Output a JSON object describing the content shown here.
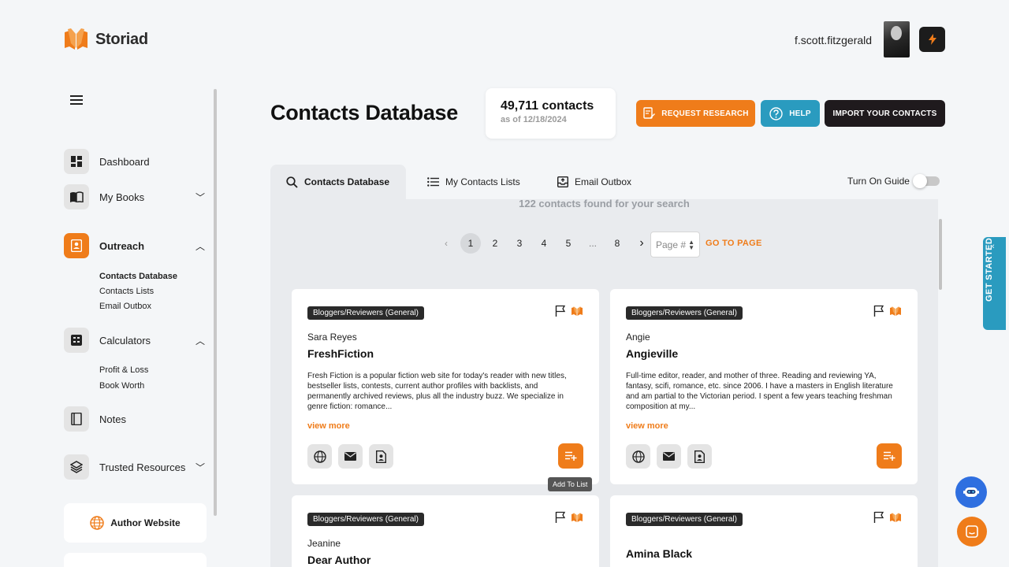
{
  "brand": {
    "name": "Storiad",
    "accent": "#ef7c1a",
    "teal": "#2a9bbf"
  },
  "user": {
    "name": "f.scott.fitzgerald"
  },
  "sidebar": {
    "items": [
      {
        "label": "Dashboard",
        "icon": "dashboard-icon"
      },
      {
        "label": "My Books",
        "icon": "book-icon"
      },
      {
        "label": "Outreach",
        "icon": "contact-card-icon"
      },
      {
        "label": "Calculators",
        "icon": "calculator-icon"
      },
      {
        "label": "Notes",
        "icon": "notebook-icon"
      },
      {
        "label": "Trusted Resources",
        "icon": "layers-icon"
      }
    ],
    "outreach_sub": [
      "Contacts Database",
      "Contacts Lists",
      "Email Outbox"
    ],
    "calculators_sub": [
      "Profit & Loss",
      "Book Worth"
    ],
    "author_website": "Author Website"
  },
  "header": {
    "title": "Contacts Database",
    "count": "49,711 contacts",
    "count_date": "as of 12/18/2024",
    "btn_research": "REQUEST RESEARCH",
    "btn_help": "HELP",
    "btn_import": "IMPORT YOUR CONTACTS"
  },
  "tabs": [
    {
      "label": "Contacts Database",
      "active": true
    },
    {
      "label": "My Contacts Lists"
    },
    {
      "label": "Email Outbox"
    }
  ],
  "guide": {
    "label": "Turn On Guide",
    "on": false
  },
  "results": {
    "found": "122 contacts found for your search"
  },
  "pagination": {
    "pages": [
      "1",
      "2",
      "3",
      "4",
      "5",
      "...",
      "8"
    ],
    "current": "1",
    "placeholder": "Page #",
    "goto": "GO TO PAGE"
  },
  "cards": [
    {
      "tag": "Bloggers/Reviewers (General)",
      "person": "Sara Reyes",
      "org": "FreshFiction",
      "desc": "Fresh Fiction is a popular fiction web site for today's reader with new titles, bestseller lists, contests, current author profiles with backlists, and permanently archived reviews, plus all the industry buzz. We specialize in genre fiction: romance...",
      "viewmore": "view more"
    },
    {
      "tag": "Bloggers/Reviewers (General)",
      "person": "Angie",
      "org": "Angieville",
      "desc": "Full-time editor, reader, and mother of three. Reading and reviewing YA, fantasy, scifi, romance, etc. since 2006. I have a masters in English literature and am partial to the Victorian period. I spent a few years teaching freshman composition at my...",
      "viewmore": "view more"
    },
    {
      "tag": "Bloggers/Reviewers (General)",
      "person": "Jeanine",
      "org": "Dear Author"
    },
    {
      "tag": "Bloggers/Reviewers (General)",
      "org": "Amina Black"
    }
  ],
  "tooltip": "Add To List",
  "get_started": "GET STARTED"
}
